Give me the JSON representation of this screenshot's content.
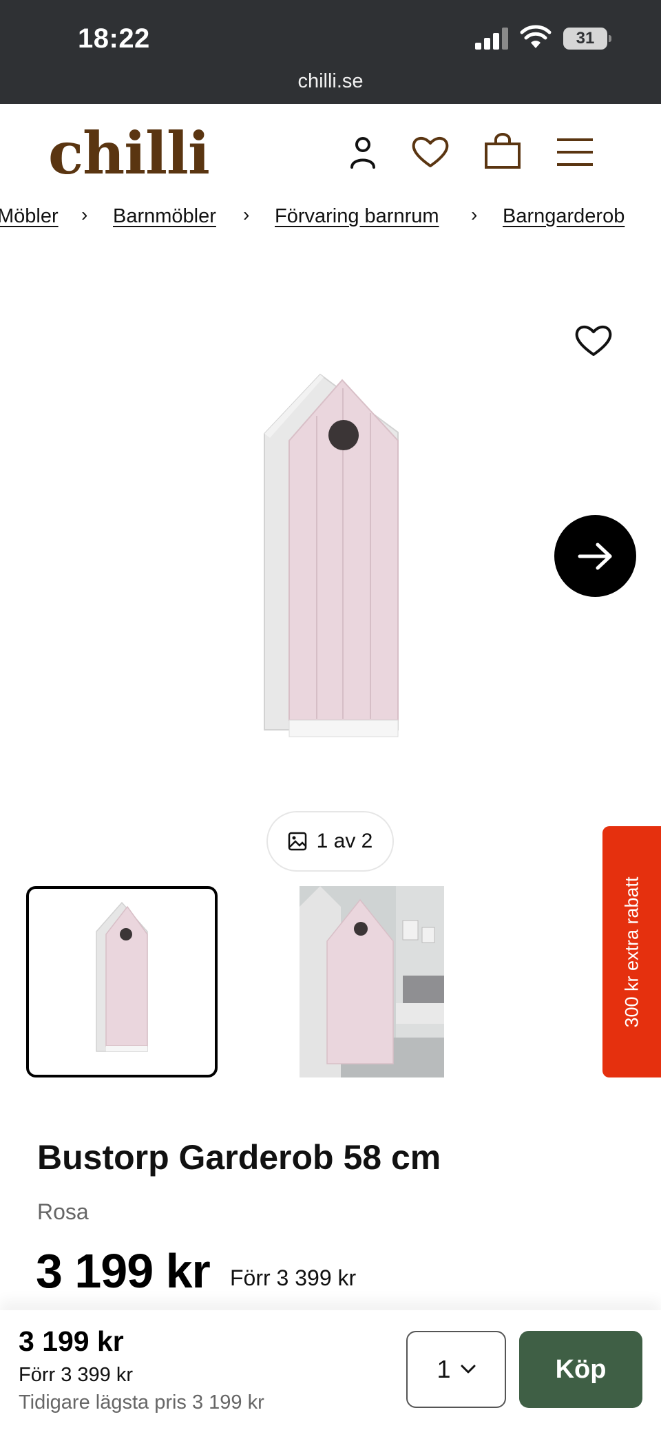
{
  "status": {
    "time": "18:22",
    "battery": "31",
    "url": "chilli.se"
  },
  "header": {
    "logo": "chilli",
    "icons": [
      "user-icon",
      "heart-icon",
      "shopping-bag-icon",
      "menu-icon"
    ]
  },
  "breadcrumb": {
    "items": [
      "Möbler",
      "Barnmöbler",
      "Förvaring barnrum",
      "Barngarderob"
    ],
    "separator": "›"
  },
  "gallery": {
    "counter": "1 av 2",
    "current": 1,
    "total": 2,
    "product_colors": {
      "door": "#e8d3da",
      "frame": "#e6e6e6"
    }
  },
  "promo": {
    "label": "300 kr extra rabatt",
    "color": "#e5300e"
  },
  "product": {
    "title": "Bustorp Garderob 58 cm",
    "variant": "Rosa",
    "price": "3 199 kr",
    "previous_price": "Förr 3 399 kr"
  },
  "sticky": {
    "price": "3 199 kr",
    "previous_price": "Förr 3 399 kr",
    "lowest_price": "Tidigare lägsta pris 3 199 kr",
    "quantity": "1",
    "buy_label": "Köp",
    "buy_color": "#3f5f45"
  }
}
